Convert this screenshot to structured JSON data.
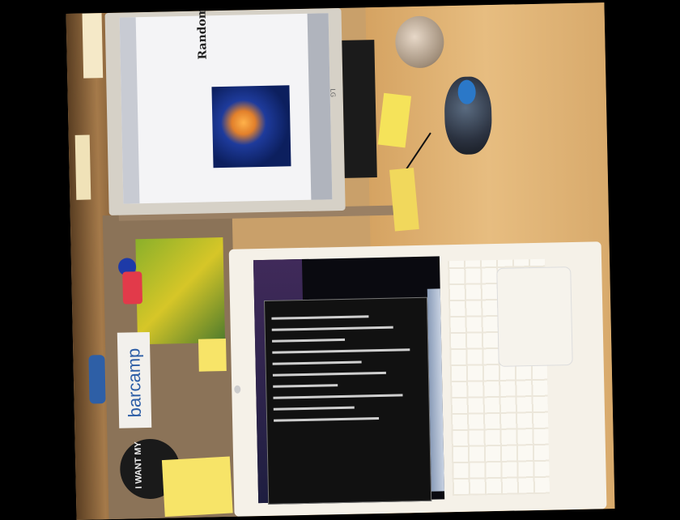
{
  "scene": {
    "colors": {
      "desk": "#e0b272",
      "monitor_bezel": "#d6d1c7",
      "laptop_body": "#f5f1e8",
      "terminal_bg": "#111111",
      "sticky_note": "#f5e35a"
    }
  },
  "monitor": {
    "brand": "LG",
    "blog_title": "Random Digital Garbage"
  },
  "stickers": {
    "barcamp": "barcamp",
    "want_my": "I WANT MY"
  },
  "laptop": {
    "screen_app": "terminal"
  }
}
